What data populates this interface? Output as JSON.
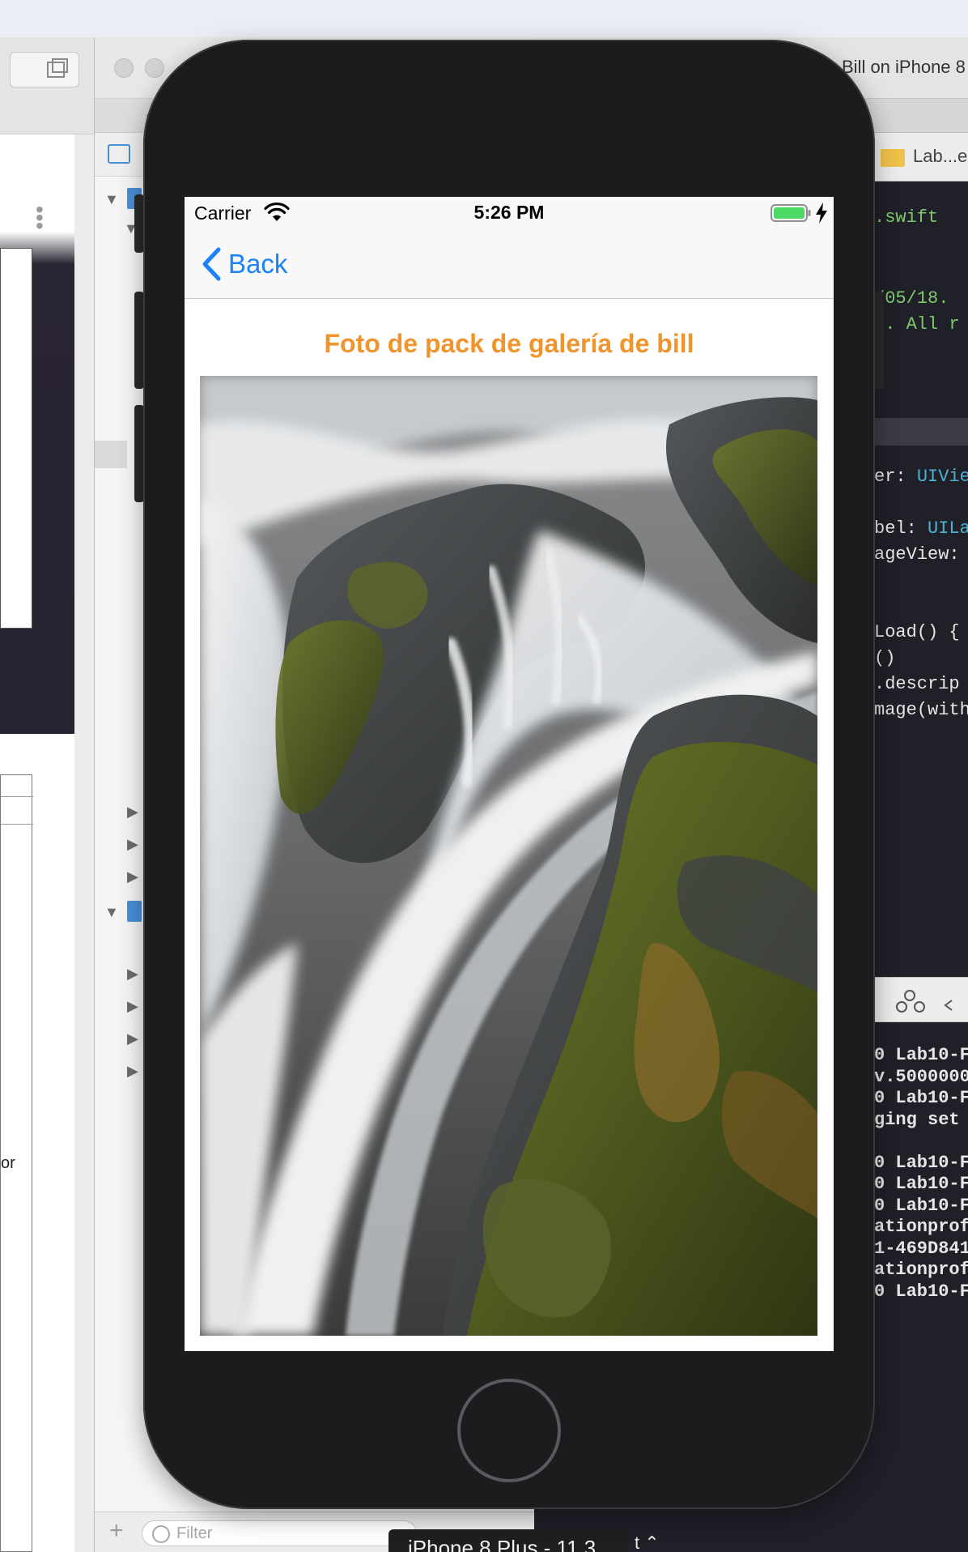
{
  "xcode": {
    "editor_title": "Bill on iPhone 8",
    "breadcrumb": "Lab...e",
    "code_lines": [
      {
        "text": ".swift",
        "color": "#7fc96b"
      },
      {
        "text": "/05/18.",
        "color": "#7fc96b"
      },
      {
        "text": "p. All r",
        "color": "#7fc96b"
      },
      {
        "text": "er: UIVie",
        "color": "#e6e6e6",
        "highlight": "UIVie",
        "highlight_color": "#4fb0d6"
      },
      {
        "text": "bel: UILa",
        "color": "#e6e6e6",
        "highlight": "UILa",
        "highlight_color": "#4fb0d6"
      },
      {
        "text": "ageView:",
        "color": "#e6e6e6"
      },
      {
        "text": "Load() {",
        "color": "#e6e6e6"
      },
      {
        "text": "()",
        "color": "#e6e6e6"
      },
      {
        "text": ".descrip",
        "color": "#e6e6e6"
      },
      {
        "text": "mage(with",
        "color": "#e6e6e6"
      }
    ],
    "console_lines": [
      "0 Lab10-F",
      "v.5000000",
      "0 Lab10-F",
      "ging set",
      "",
      "0 Lab10-F",
      "0 Lab10-F",
      "0 Lab10-F",
      "ationprof",
      "1-469D841",
      "ationprof",
      "0 Lab10-F"
    ],
    "filter_placeholder": "Filter",
    "device_name": "iPhone 8 Plus - 11.3",
    "left_fragment": "or",
    "left_plus": "+",
    "nav_plus": "+"
  },
  "simulator": {
    "status_bar": {
      "carrier": "Carrier",
      "time": "5:26 PM",
      "battery_color": "#4cd964"
    },
    "nav_bar": {
      "back_label": "Back",
      "tint_color": "#1a82fb"
    },
    "content": {
      "title": "Foto de pack de galería de bill",
      "title_color": "#f0942d",
      "image_icon": "waterfall-photo"
    }
  }
}
